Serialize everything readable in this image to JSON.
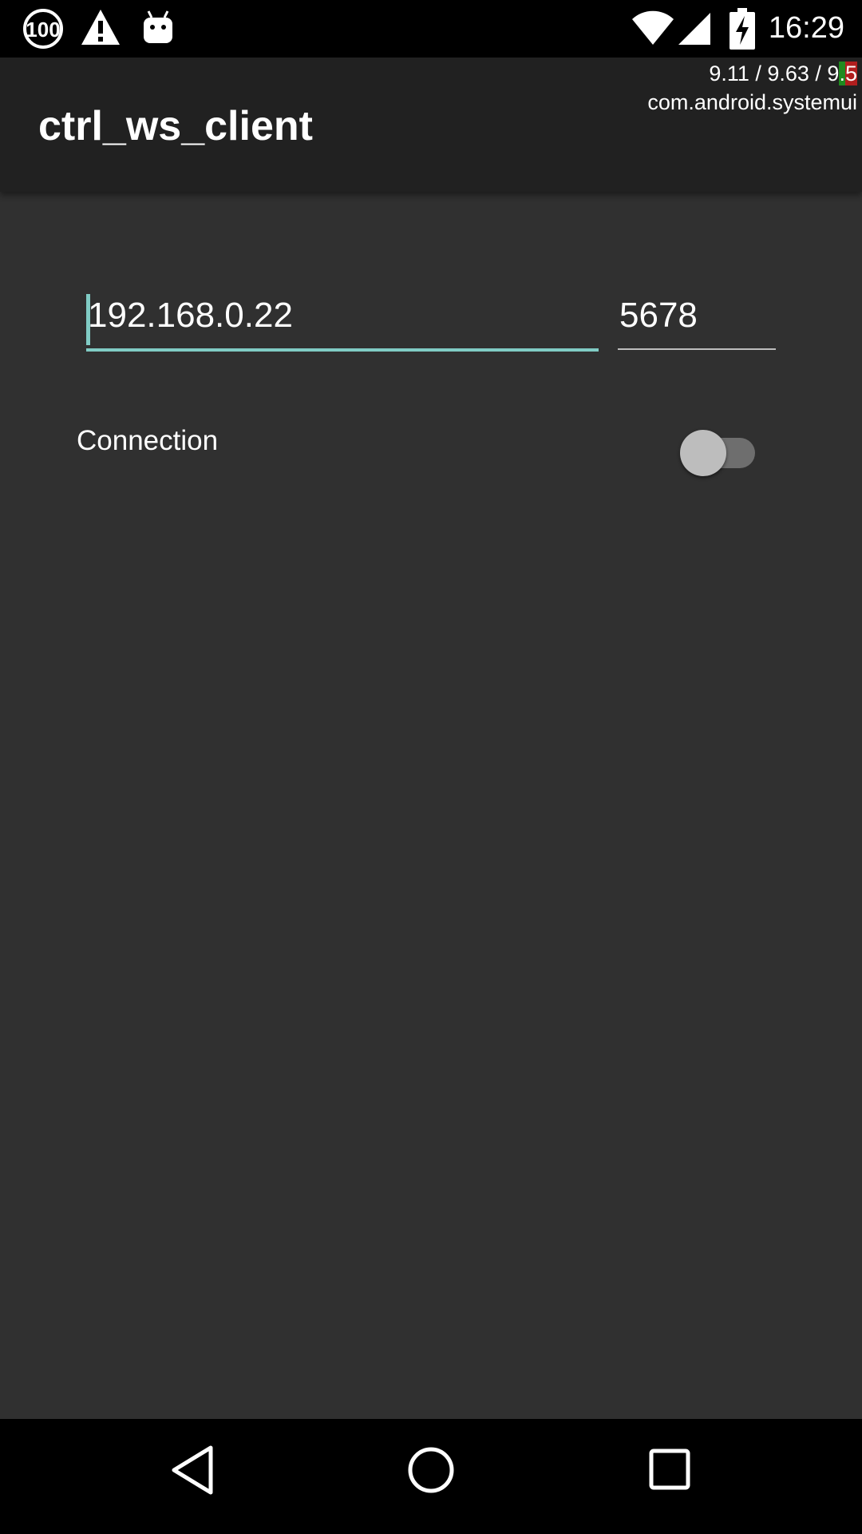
{
  "status_bar": {
    "time": "16:29",
    "icons": [
      "circle-100-icon",
      "warning-icon",
      "android-icon",
      "wifi-icon",
      "cell-signal-icon",
      "battery-charging-icon"
    ],
    "badge_text": "100"
  },
  "overlay": {
    "line1_a": "9.11 / 9.63 / 9",
    "line1_b": ".",
    "line1_c": "5",
    "line2": "com.android.systemui"
  },
  "app_bar": {
    "title": "ctrl_ws_client"
  },
  "form": {
    "host_value": "192.168.0.22",
    "port_value": "5678",
    "accent_color": "#80cbc4"
  },
  "connection": {
    "label": "Connection",
    "enabled": false
  },
  "nav": {
    "back": "back-icon",
    "home": "home-icon",
    "recents": "recents-icon"
  }
}
